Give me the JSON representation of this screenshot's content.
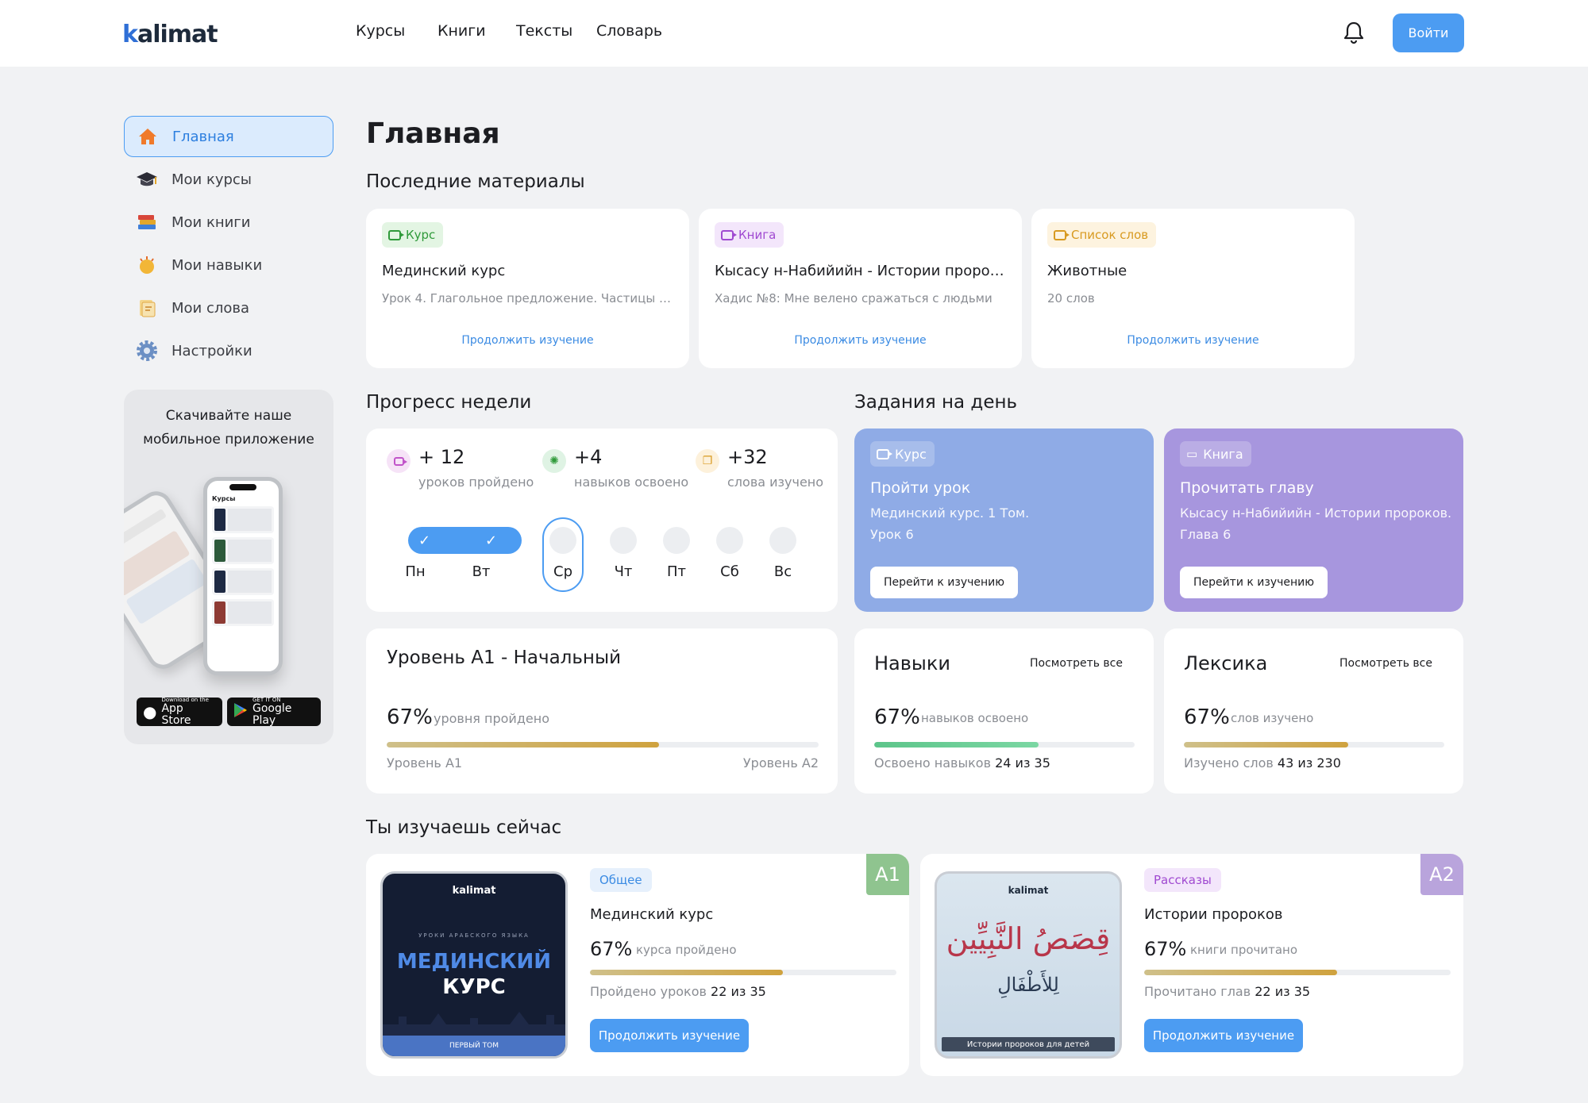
{
  "header": {
    "logo": "kalimat",
    "nav": [
      "Курсы",
      "Книги",
      "Тексты",
      "Словарь"
    ],
    "login": "Войти"
  },
  "sidebar": {
    "items": [
      {
        "label": "Главная",
        "icon": "home-icon"
      },
      {
        "label": "Мои курсы",
        "icon": "graduation-cap-icon"
      },
      {
        "label": "Мои книги",
        "icon": "books-icon"
      },
      {
        "label": "Мои навыки",
        "icon": "skills-icon"
      },
      {
        "label": "Мои слова",
        "icon": "words-icon"
      },
      {
        "label": "Настройки",
        "icon": "gear-icon"
      }
    ],
    "promo": {
      "line1": "Скачивайте наше",
      "line2": "мобильное приложение",
      "appstore_small": "Download on the",
      "appstore_big": "App Store",
      "gplay_small": "GET IT ON",
      "gplay_big": "Google Play",
      "phone_header": "Курсы"
    }
  },
  "page_title": "Главная",
  "recent": {
    "title": "Последние материалы",
    "cards": [
      {
        "badge": "Курс",
        "title": "Мединский курс",
        "subtitle": "Урок 4. Глагольное предложение. Частицы «...",
        "link": "Продолжить изучение"
      },
      {
        "badge": "Книга",
        "title": "Кысасу н-Набийийн - Истории пророков",
        "subtitle": "Хадис №8: Мне велено сражаться с людьми",
        "link": "Продолжить изучение"
      },
      {
        "badge": "Список слов",
        "title": "Животные",
        "subtitle": "20 слов",
        "link": "Продолжить изучение"
      }
    ]
  },
  "week": {
    "title": "Прогресс недели",
    "stats": [
      {
        "value": "+ 12",
        "label": "уроков пройдено"
      },
      {
        "value": "+4",
        "label": "навыков освоено"
      },
      {
        "value": "+32",
        "label": "слова изучено"
      }
    ],
    "days": [
      "Пн",
      "Вт",
      "Ср",
      "Чт",
      "Пт",
      "Сб",
      "Вс"
    ]
  },
  "tasks": {
    "title": "Задания на день",
    "items": [
      {
        "badge": "Курс",
        "title": "Пройти урок",
        "line1": "Мединский курс. 1 Том.",
        "line2": "Урок 6",
        "button": "Перейти к изучению",
        "color": "#8fabe6"
      },
      {
        "badge": "Книга",
        "title": "Прочитать главу",
        "line1": "Кысасу н-Набийийн - Истории пророков.",
        "line2": "Глава 6",
        "button": "Перейти к изучению",
        "color": "#a796de"
      }
    ]
  },
  "level": {
    "title": "Уровень А1 - Начальный",
    "percent": "67%",
    "percent_label": "уровня пройдено",
    "progress": 0.63,
    "from": "Уровень А1",
    "to": "Уровень А2"
  },
  "skills": {
    "title": "Навыки",
    "view_all": "Посмотреть все",
    "percent": "67%",
    "percent_label": "навыков освоено",
    "progress": 0.63,
    "footer_label": "Освоено навыков",
    "footer_value": "24 из 35"
  },
  "vocab": {
    "title": "Лексика",
    "view_all": "Посмотреть все",
    "percent": "67%",
    "percent_label": "слов изучено",
    "progress": 0.63,
    "footer_label": "Изучено слов",
    "footer_value": "43 из 230"
  },
  "now": {
    "title": "Ты изучаешь сейчас",
    "items": [
      {
        "tag": "Общее",
        "level": "A1",
        "level_color": "#8fc48f",
        "title": "Мединский курс",
        "percent": "67%",
        "percent_label": "курса пройдено",
        "progress": 0.63,
        "footer_label": "Пройдено уроков",
        "footer_value": "22 из 35",
        "button": "Продолжить изучение",
        "cover": {
          "brand": "kalimat",
          "small": "УРОКИ АРАБСКОГО ЯЗЫКА",
          "big1": "МЕДИНСКИЙ",
          "big2": "КУРС",
          "bottom": "ПЕРВЫЙ ТОМ"
        }
      },
      {
        "tag": "Рассказы",
        "level": "A2",
        "level_color": "#b9a4dc",
        "title": "Истории пророков",
        "percent": "67%",
        "percent_label": "книги прочитано",
        "progress": 0.63,
        "footer_label": "Прочитано глав",
        "footer_value": "22 из 35",
        "button": "Продолжить изучение",
        "cover": {
          "brand": "kalimat",
          "arabic1": "قِصَصُ النَّبِيِّين",
          "arabic2": "لِلأَطْفَالِ",
          "bottom": "Истории пророков для детей"
        }
      }
    ]
  }
}
